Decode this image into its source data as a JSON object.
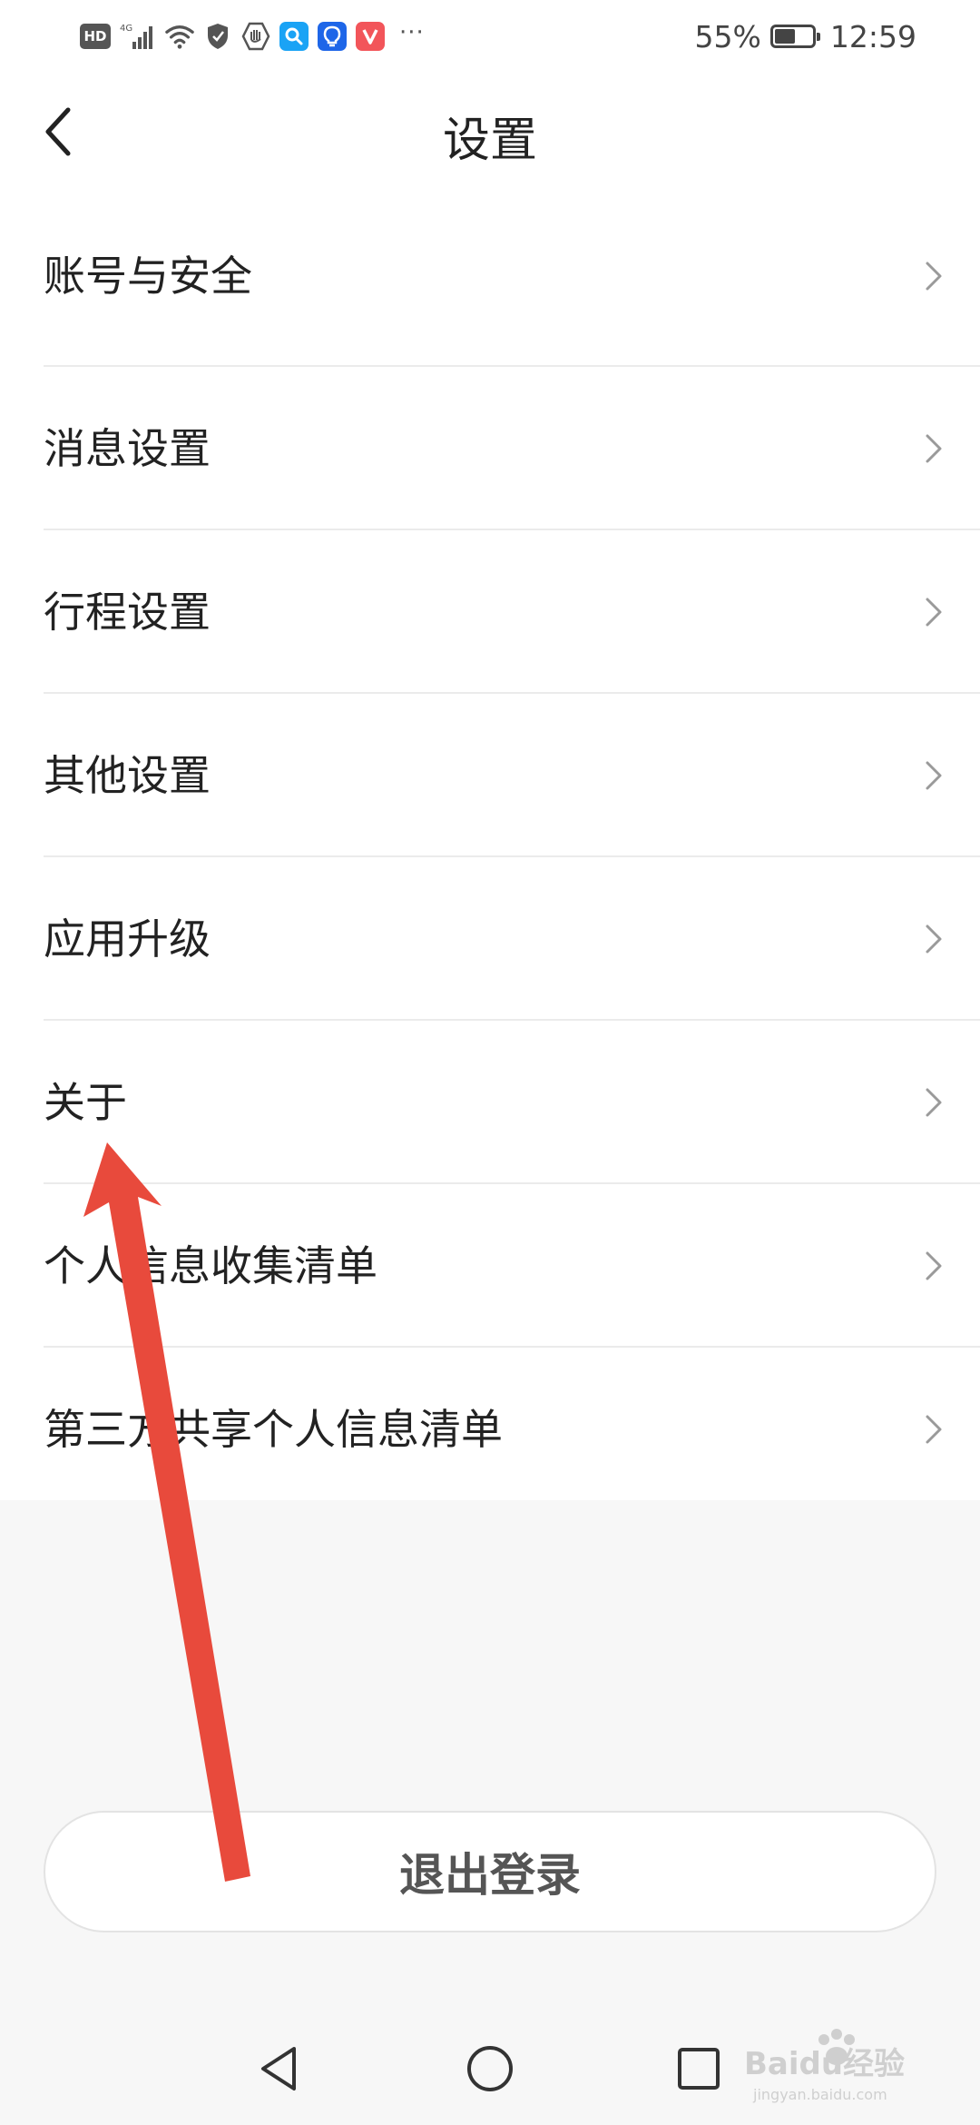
{
  "status_bar": {
    "hd_label": "HD",
    "network_label": "4G",
    "more_label": "···",
    "battery_text": "55%",
    "battery_level": 0.55,
    "time": "12:59",
    "app_icons": [
      {
        "name": "search-app-icon",
        "color": "#1aa3f5",
        "glyph": "🔍︎"
      },
      {
        "name": "bulb-app-icon",
        "color": "#1e66e8",
        "glyph": "💡︎"
      },
      {
        "name": "v-app-icon",
        "color": "#f2555a",
        "glyph": "V"
      }
    ]
  },
  "header": {
    "title": "设置"
  },
  "settings": {
    "items": [
      {
        "label": "账号与安全"
      },
      {
        "label": "消息设置"
      },
      {
        "label": "行程设置"
      },
      {
        "label": "其他设置"
      },
      {
        "label": "应用升级"
      },
      {
        "label": "关于"
      },
      {
        "label": "个人信息收集清单"
      },
      {
        "label": "第三方共享个人信息清单"
      }
    ]
  },
  "logout": {
    "label": "退出登录"
  },
  "annotation": {
    "color": "#e84a3c"
  },
  "watermark": {
    "text": "Baidu经验",
    "subtext": "jingyan.baidu.com"
  }
}
